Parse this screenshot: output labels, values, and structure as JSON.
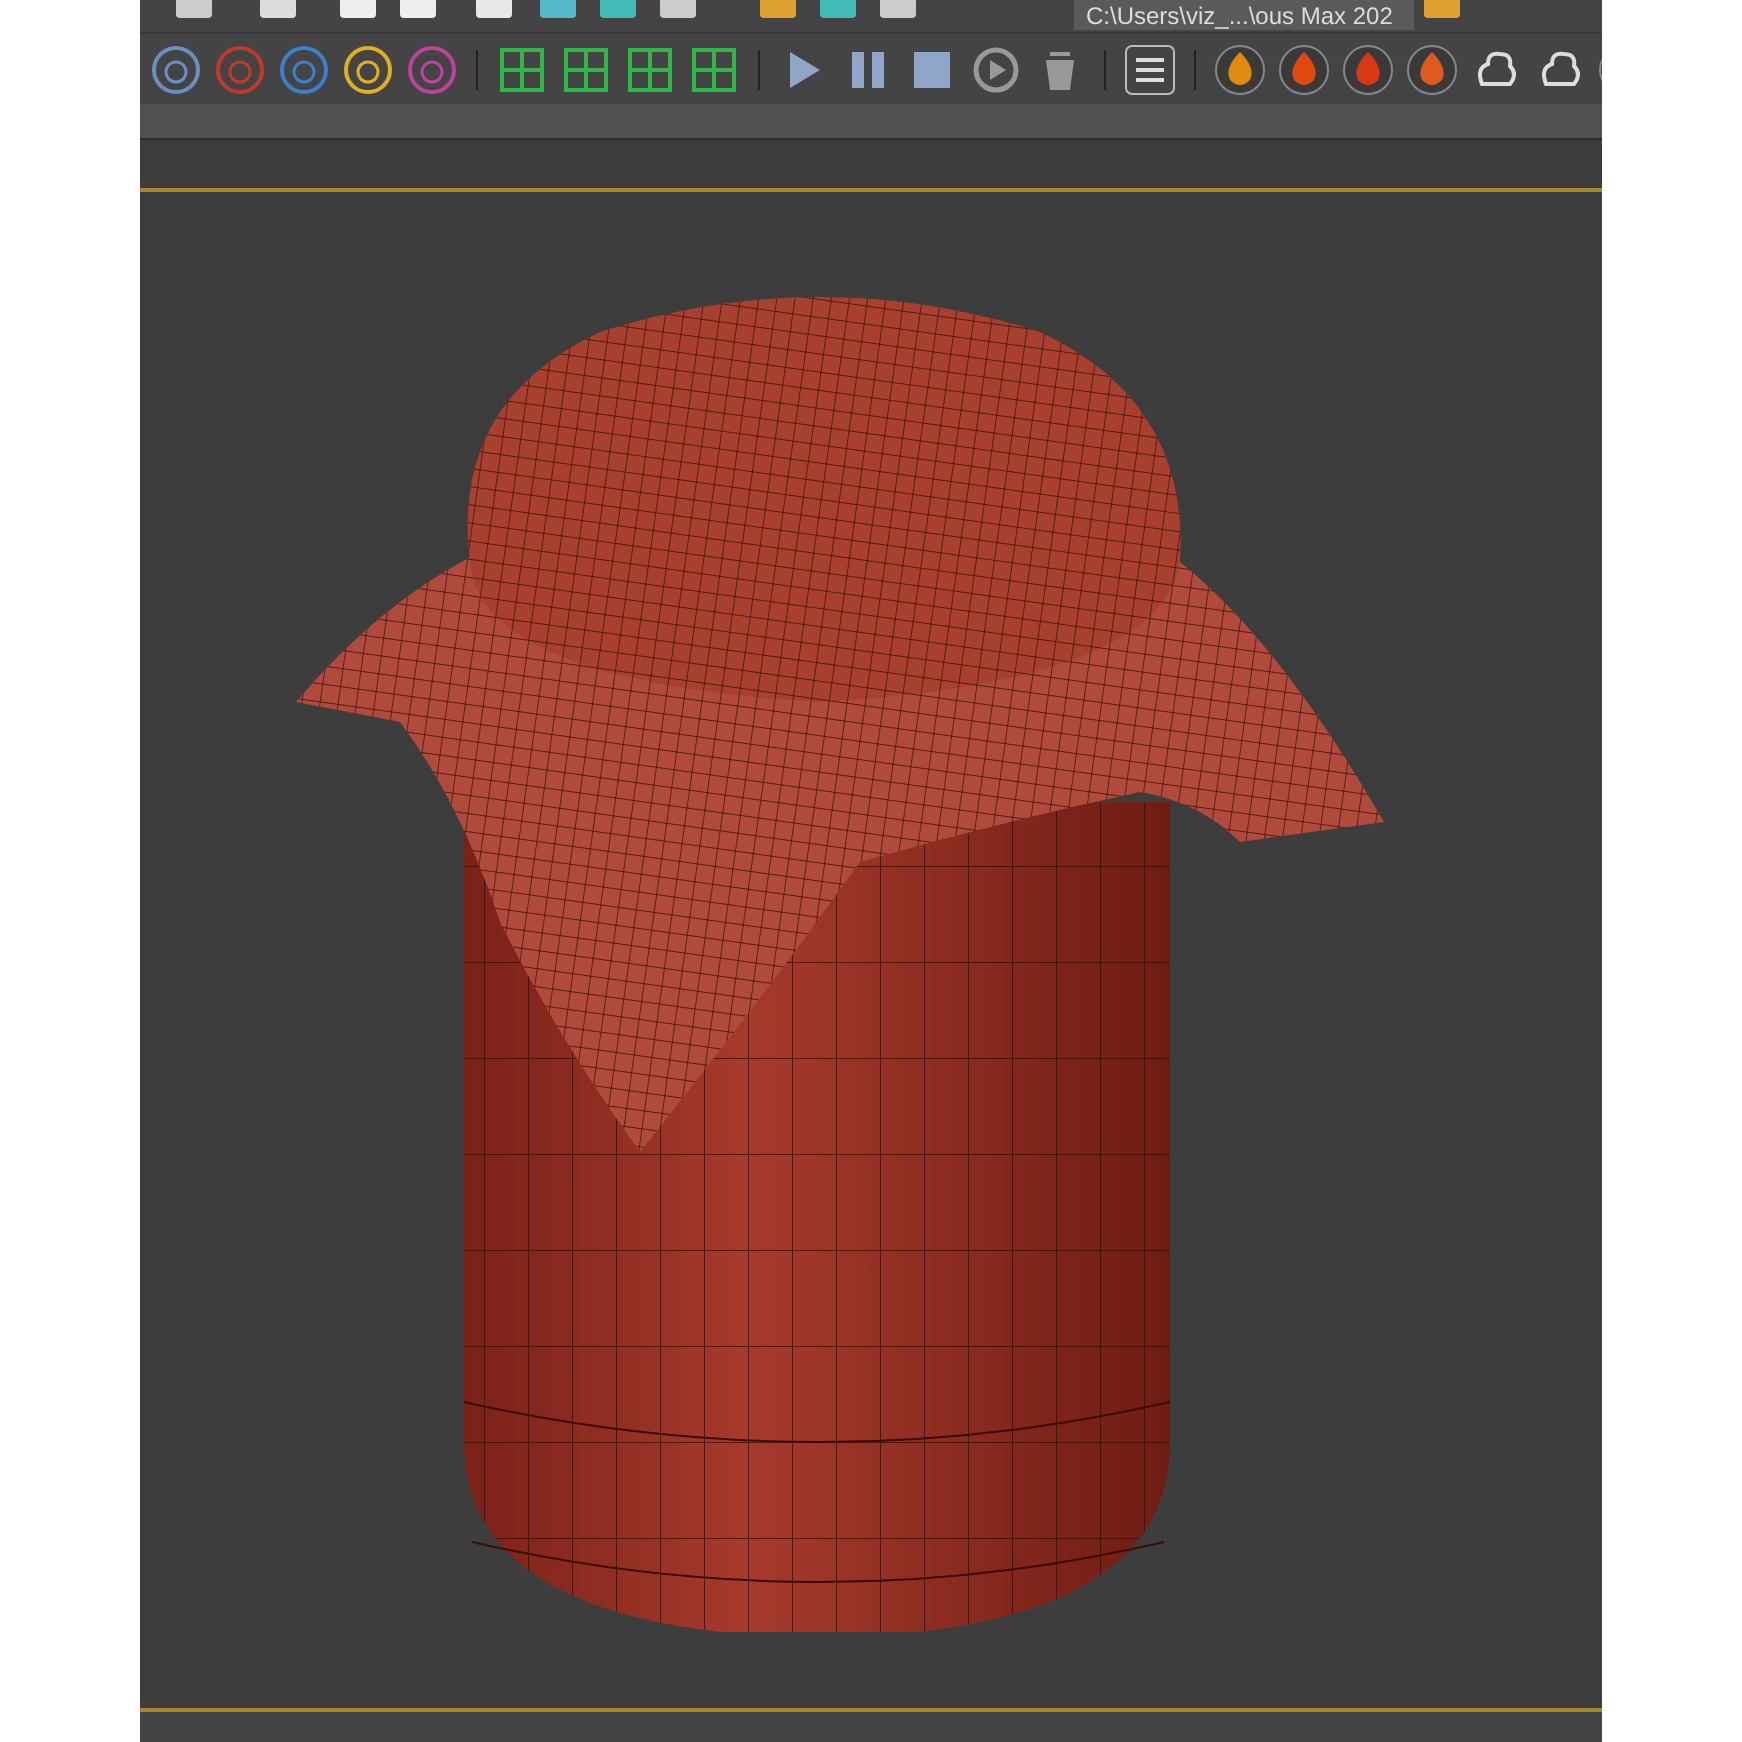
{
  "top_toolbar": {
    "path_field": {
      "value": "C:\\Users\\viz_...\\ous Max 202"
    }
  },
  "viewport": {
    "active": true
  }
}
